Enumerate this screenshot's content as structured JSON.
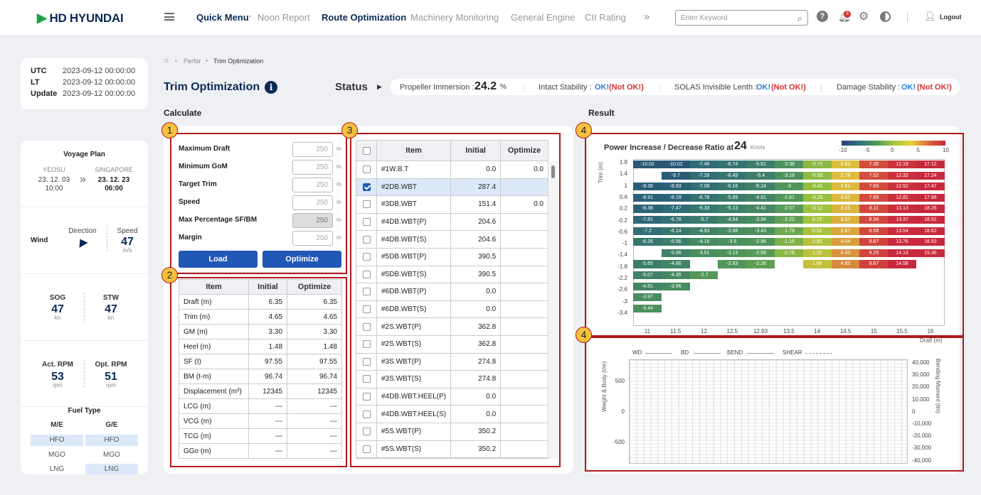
{
  "header": {
    "logo": "HD HYUNDAI",
    "nav": [
      "Quick Menu",
      "Noon Report",
      "Route Optimization",
      "Machinery Monitoring",
      "General Engine",
      "CII Rating"
    ],
    "search_placeholder": "Enter Keyword",
    "notifications": "3",
    "logout": "Logout"
  },
  "time": {
    "utc_label": "UTC",
    "utc": "2023-09-12 00:00:00",
    "lt_label": "LT",
    "lt": "2023-09-12 00:00:00",
    "update_label": "Update",
    "update": "2023-09-12 00:00:00"
  },
  "voyage": {
    "title": "Voyage Plan",
    "from": "YEOSU",
    "from_date": "23. 12. 03",
    "from_time": "10:00",
    "to": "SINGAPORE",
    "to_date": "23. 12. 23",
    "to_time": "06:00"
  },
  "wind": {
    "label": "Wind",
    "direction_label": "Direction",
    "speed_label": "Speed",
    "speed": "47",
    "speed_unit": "m/s"
  },
  "sog": {
    "label": "SOG",
    "value": "47",
    "unit": "kn"
  },
  "stw": {
    "label": "STW",
    "value": "47",
    "unit": "kn"
  },
  "rpm": {
    "act_label": "Act. RPM",
    "act": "53",
    "opt_label": "Opt. RPM",
    "opt": "51",
    "unit": "rpm"
  },
  "fuel": {
    "title": "Fuel Type",
    "me": "M/E",
    "ge": "G/E",
    "rows": [
      [
        "HFO",
        "HFO"
      ],
      [
        "MGO",
        "MGO"
      ],
      [
        "LNG",
        "LNG"
      ]
    ]
  },
  "breadcrumb": [
    "Perfor",
    "Trim Optimization"
  ],
  "page_title": "Trim Optimization",
  "status": {
    "label": "Status",
    "prop_label": "Propeller Immersion :",
    "prop_value": "24.2",
    "prop_unit": "%",
    "items": [
      {
        "label": "Intact Stability :",
        "ok": "OK!",
        "nok": "(Not OK!)"
      },
      {
        "label": "SOLAS Invisible Lenth :",
        "ok": "OK!",
        "nok": "(Not OK!)"
      },
      {
        "label": "Damage Stability :",
        "ok": "OK!",
        "nok": "(Not OK!)"
      }
    ]
  },
  "calculate_title": "Calculate",
  "result_title": "Result",
  "markers": [
    "1",
    "2",
    "3",
    "4",
    "4"
  ],
  "params": [
    {
      "label": "Maximum Draft",
      "value": "250",
      "unit": "m"
    },
    {
      "label": "Minimum GoM",
      "value": "250",
      "unit": "m"
    },
    {
      "label": "Target Trim",
      "value": "250",
      "unit": "m"
    },
    {
      "label": "Speed",
      "value": "250",
      "unit": "m"
    },
    {
      "label": "Max Percentage SF/BM",
      "value": "250",
      "unit": "m"
    },
    {
      "label": "Margin",
      "value": "250",
      "unit": "m"
    }
  ],
  "buttons": {
    "load": "Load",
    "optimize": "Optimize"
  },
  "table2": {
    "headers": [
      "Item",
      "Initial",
      "Optimize"
    ],
    "rows": [
      [
        "Draft (m)",
        "6.35",
        "6.35"
      ],
      [
        "Trim (m)",
        "4.65",
        "4.65"
      ],
      [
        "GM (m)",
        "3.30",
        "3.30"
      ],
      [
        "Heel (m)",
        "1.48",
        "1.48"
      ],
      [
        "SF (t)",
        "97.55",
        "97.55"
      ],
      [
        "BM (t-m)",
        "96.74",
        "96.74"
      ],
      [
        "Displacement (m³)",
        "12345",
        "12345"
      ],
      [
        "LCG (m)",
        "---",
        "---"
      ],
      [
        "VCG (m)",
        "---",
        "---"
      ],
      [
        "TCG (m)",
        "---",
        "---"
      ],
      [
        "GGo (m)",
        "---",
        "---"
      ]
    ]
  },
  "table3": {
    "headers": [
      "Item",
      "Initial",
      "Optimize"
    ],
    "rows": [
      [
        "#1W.B.T",
        "0.0",
        "0.0"
      ],
      [
        "#2DB.WBT",
        "287.4",
        ""
      ],
      [
        "#3DB.WBT",
        "151.4",
        "0.0"
      ],
      [
        "#4DB.WBT(P)",
        "204.6",
        ""
      ],
      [
        "#4DB.WBT(S)",
        "204.6",
        ""
      ],
      [
        "#5DB.WBT(P)",
        "390.5",
        ""
      ],
      [
        "#5DB.WBT(S)",
        "390.5",
        ""
      ],
      [
        "#6DB.WBT(P)",
        "0.0",
        ""
      ],
      [
        "#6DB.WBT(S)",
        "0.0",
        ""
      ],
      [
        "#2S.WBT(P)",
        "362.8",
        ""
      ],
      [
        "#2S.WBT(S)",
        "362.8",
        ""
      ],
      [
        "#3S.WBT(P)",
        "274.8",
        ""
      ],
      [
        "#3S.WBT(S)",
        "274.8",
        ""
      ],
      [
        "#4DB.WBT.HEEL(P)",
        "0.0",
        ""
      ],
      [
        "#4DB.WBT.HEEL(S)",
        "0.0",
        ""
      ],
      [
        "#5S.WBT(P)",
        "350.2",
        ""
      ],
      [
        "#5S.WBT(S)",
        "350.2",
        ""
      ]
    ],
    "checked": [
      1
    ]
  },
  "chart_data": [
    {
      "type": "heatmap",
      "title": "Power Increase / Decrease Ratio at",
      "speed": "24",
      "speed_unit": "Knots",
      "ylabel": "Trim (m)",
      "xlabel": "Draft (m)",
      "colorbar_ticks": [
        "-10",
        "-5",
        "0",
        "5",
        "10"
      ],
      "x": [
        "11",
        "11.5",
        "12",
        "12.5",
        "12.93",
        "13.5",
        "14",
        "14.5",
        "15",
        "15.5",
        "16"
      ],
      "y": [
        "1.8",
        "1.4",
        "1",
        "0.6",
        "0.2",
        "-0.2",
        "-0.6",
        "-1",
        "-1.4",
        "-1.8",
        "-2.2",
        "-2.6",
        "-3",
        "-3.4"
      ],
      "values": [
        [
          "-10.02",
          "-10.02",
          "-7.46",
          "-6.74",
          "-5.61",
          "-3.38",
          "-0.72",
          "2.83",
          "7.38",
          "12.19",
          "17.12"
        ],
        [
          "",
          "-9.7",
          "-7.29",
          "-6.49",
          "-5.4",
          "-3.19",
          "-0.55",
          "2.78",
          "7.52",
          "12.32",
          "17.24"
        ],
        [
          "-9.39",
          "-8.93",
          "-7.08",
          "-6.16",
          "-5.14",
          "-3",
          "-0.41",
          "2.91",
          "7.69",
          "12.52",
          "17.47"
        ],
        [
          "-8.91",
          "-8.19",
          "-6.78",
          "-5.69",
          "-4.81",
          "-2.81",
          "-0.28",
          "3.02",
          "7.89",
          "12.81",
          "17.86"
        ],
        [
          "-8.38",
          "-7.47",
          "-6.33",
          "-5.13",
          "-4.41",
          "-2.57",
          "-0.12",
          "3.16",
          "8.11",
          "13.13",
          "18.26"
        ],
        [
          "-7.81",
          "-6.78",
          "-5.7",
          "-4.54",
          "-3.94",
          "-2.22",
          "0.15",
          "3.37",
          "8.34",
          "13.37",
          "18.52"
        ],
        [
          "-7.2",
          "-6.14",
          "-4.93",
          "-3.98",
          "-3.43",
          "-1.79",
          "0.52",
          "3.67",
          "8.58",
          "13.54",
          "18.62"
        ],
        [
          "-6.26",
          "-5.56",
          "-4.16",
          "-3.5",
          "-2.96",
          "-1.15",
          "0.93",
          "4.04",
          "8.87",
          "13.76",
          "18.93"
        ],
        [
          "",
          "-5.06",
          "-3.51",
          "-3.13",
          "-2.58",
          "-0.78",
          "1.32",
          "4.43",
          "9.25",
          "14.13",
          "19.36"
        ],
        [
          "-5.65",
          "-4.66",
          "",
          "-2.83",
          "-2.26",
          "",
          "1.69",
          "4.83",
          "9.67",
          "14.58",
          ""
        ],
        [
          "-5.07",
          "-4.35",
          "-2.7",
          "",
          "",
          "",
          "",
          "",
          "",
          "",
          ""
        ],
        [
          "-4.51",
          "-3.96",
          "",
          "",
          "",
          "",
          "",
          "",
          "",
          "",
          ""
        ],
        [
          "-3.97",
          "",
          "",
          "",
          "",
          "",
          "",
          "",
          "",
          "",
          ""
        ],
        [
          "-3.44",
          "",
          "",
          "",
          "",
          "",
          "",
          "",
          "",
          "",
          ""
        ]
      ]
    },
    {
      "type": "line",
      "legend": [
        "WD",
        "BD",
        "BEND",
        "SHEAR"
      ],
      "ylabel": "Weight & Body (t/m)",
      "ylabel2": "Bending Moment (tm)",
      "yticks": [
        "500",
        "0",
        "-500"
      ],
      "y2ticks": [
        "40,000",
        "30,000",
        "20,000",
        "10,000",
        "0",
        "-10,000",
        "-20,000",
        "-30,000",
        "-40,000"
      ]
    }
  ]
}
